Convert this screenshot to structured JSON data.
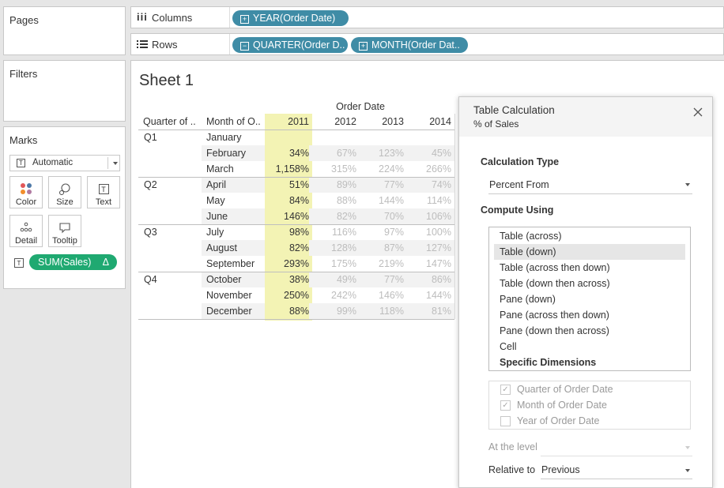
{
  "side": {
    "pages_title": "Pages",
    "filters_title": "Filters",
    "marks_title": "Marks",
    "mark_type": "Automatic",
    "mark_buttons": [
      "Color",
      "Size",
      "Text",
      "Detail",
      "Tooltip"
    ],
    "measure_pill": "SUM(Sales)",
    "measure_delta": "Δ"
  },
  "shelves": {
    "columns_label": "Columns",
    "rows_label": "Rows",
    "columns_pills": [
      "YEAR(Order Date)"
    ],
    "rows_pills": [
      "QUARTER(Order D..",
      "MONTH(Order Dat.."
    ]
  },
  "sheet": {
    "title": "Sheet 1",
    "col_header_title": "Order Date",
    "row_headers": [
      "Quarter of ..",
      "Month of O.."
    ],
    "years": [
      "2011",
      "2012",
      "2013",
      "2014"
    ],
    "quarters": [
      "Q1",
      "Q2",
      "Q3",
      "Q4"
    ],
    "rows": [
      {
        "month": "January",
        "v": [
          "",
          "",
          "",
          ""
        ]
      },
      {
        "month": "February",
        "v": [
          "34%",
          "67%",
          "123%",
          "45%"
        ]
      },
      {
        "month": "March",
        "v": [
          "1,158%",
          "315%",
          "224%",
          "266%"
        ]
      },
      {
        "month": "April",
        "v": [
          "51%",
          "89%",
          "77%",
          "74%"
        ]
      },
      {
        "month": "May",
        "v": [
          "84%",
          "88%",
          "144%",
          "114%"
        ]
      },
      {
        "month": "June",
        "v": [
          "146%",
          "82%",
          "70%",
          "106%"
        ]
      },
      {
        "month": "July",
        "v": [
          "98%",
          "116%",
          "97%",
          "100%"
        ]
      },
      {
        "month": "August",
        "v": [
          "82%",
          "128%",
          "87%",
          "127%"
        ]
      },
      {
        "month": "September",
        "v": [
          "293%",
          "175%",
          "219%",
          "147%"
        ]
      },
      {
        "month": "October",
        "v": [
          "38%",
          "49%",
          "77%",
          "86%"
        ]
      },
      {
        "month": "November",
        "v": [
          "250%",
          "242%",
          "146%",
          "144%"
        ]
      },
      {
        "month": "December",
        "v": [
          "88%",
          "99%",
          "118%",
          "81%"
        ]
      }
    ]
  },
  "dialog": {
    "title": "Table Calculation",
    "subtitle": "% of Sales",
    "calc_type_label": "Calculation Type",
    "calc_type_value": "Percent From",
    "compute_label": "Compute Using",
    "compute_options": [
      "Table (across)",
      "Table (down)",
      "Table (across then down)",
      "Table (down then across)",
      "Pane (down)",
      "Pane (across then down)",
      "Pane (down then across)",
      "Cell",
      "Specific Dimensions"
    ],
    "compute_selected": "Table (down)",
    "dimensions": [
      {
        "label": "Quarter of Order Date",
        "checked": true
      },
      {
        "label": "Month of Order Date",
        "checked": true
      },
      {
        "label": "Year of Order Date",
        "checked": false
      }
    ],
    "at_level_label": "At the level",
    "relative_label": "Relative to",
    "relative_value": "Previous"
  },
  "colors": {
    "pill": "#3f8ca6",
    "measure_pill": "#1fa971",
    "highlight": "#f3f3b4"
  }
}
